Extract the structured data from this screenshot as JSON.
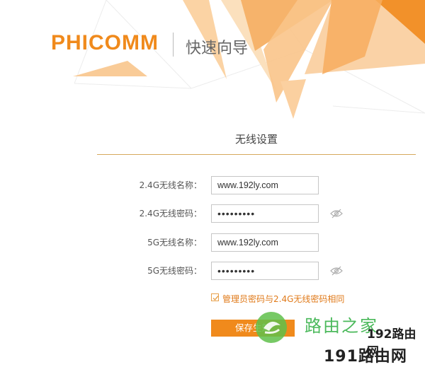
{
  "header": {
    "brand": "PHICOMM",
    "title": "快速向导"
  },
  "section": {
    "title": "无线设置"
  },
  "form": {
    "fields": [
      {
        "label": "2.4G无线名称：",
        "value": "www.192ly.com",
        "type": "text"
      },
      {
        "label": "2.4G无线密码：",
        "value": "•••••••••",
        "type": "password",
        "eye_icon": "eye-slash-icon"
      },
      {
        "label": "5G无线名称：",
        "value": "www.192ly.com",
        "type": "text"
      },
      {
        "label": "5G无线密码：",
        "value": "•••••••••",
        "type": "password",
        "eye_icon": "eye-slash-icon"
      }
    ],
    "sync_checkbox": {
      "label": "管理员密码与2.4G无线密码相同",
      "checked": true
    },
    "save_button": "保存生效"
  },
  "watermarks": {
    "site_cn": "路由之家",
    "site_192": "192路由网",
    "site_191": "191路由网"
  },
  "colors": {
    "accent": "#f08a1c",
    "divider": "#d6a85c",
    "checkbox_label": "#e07a1a"
  }
}
